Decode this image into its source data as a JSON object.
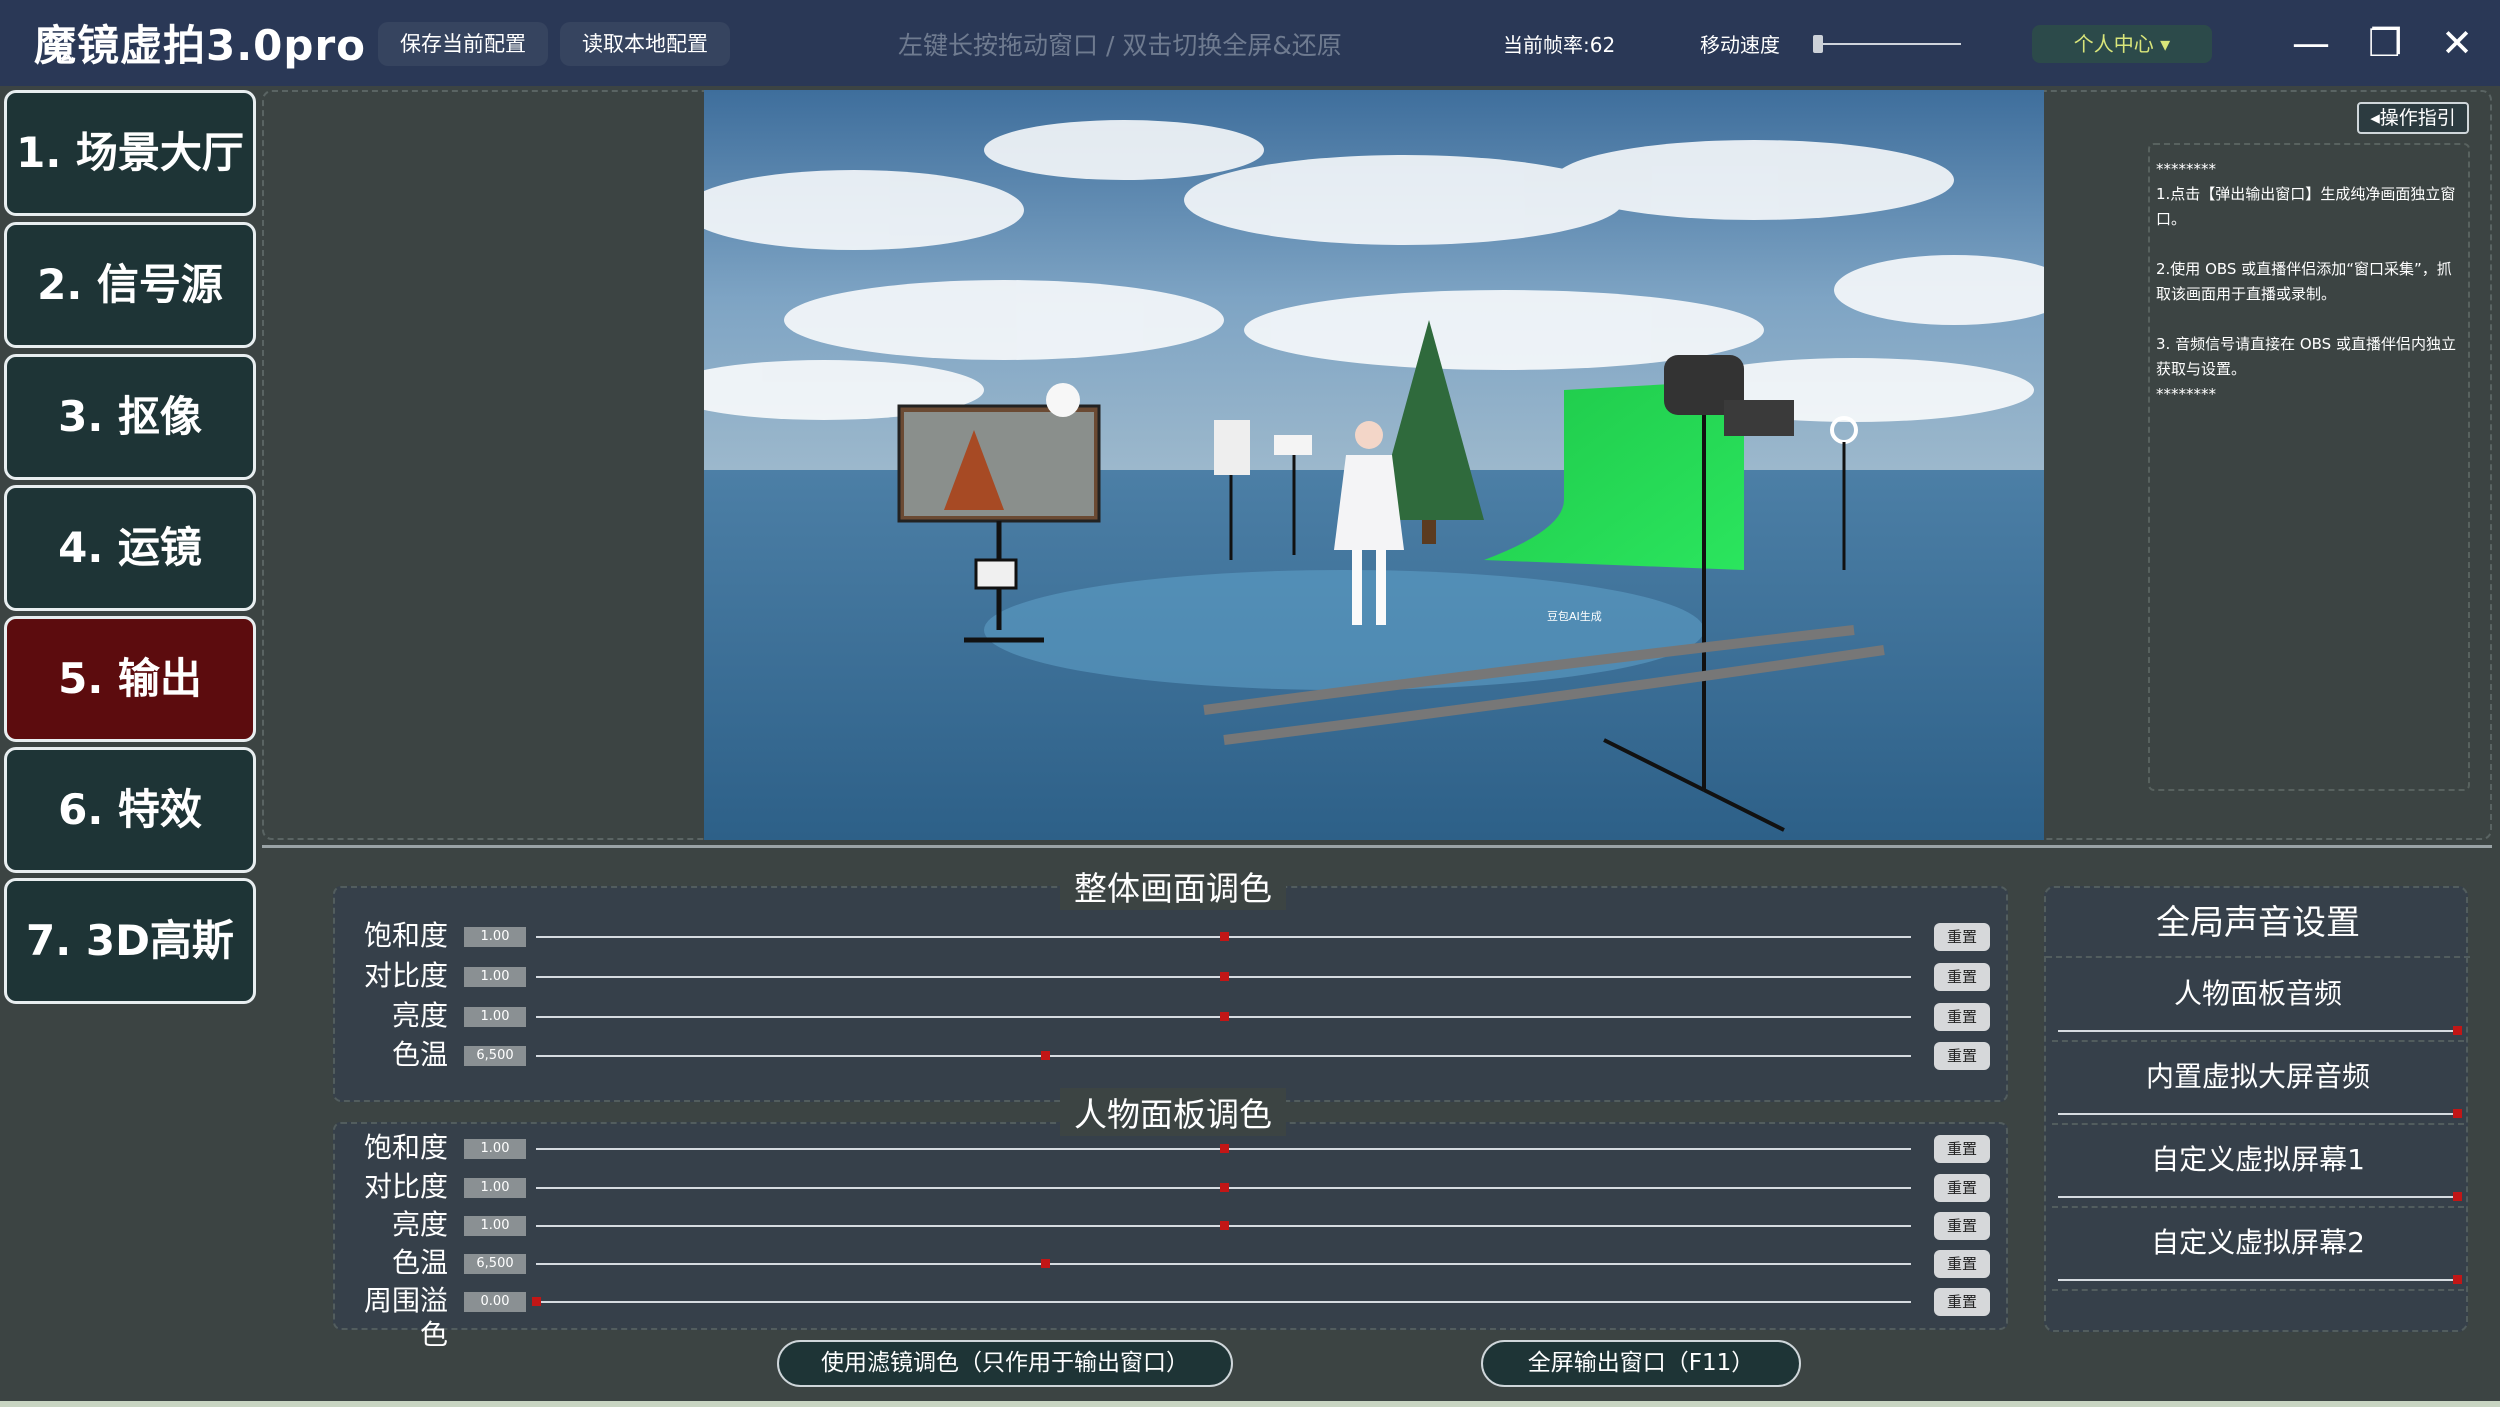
{
  "app": {
    "title": "魔镜虚拍3.0pro",
    "save_config": "保存当前配置",
    "load_config": "读取本地配置",
    "hint": "左键长按拖动窗口 / 双击切换全屏&还原",
    "fps_label": "当前帧率:62",
    "speed_label": "移动速度",
    "user_center": "个人中心 ▾",
    "window_controls": {
      "minimize": "—",
      "maximize": "❐",
      "close": "✕"
    }
  },
  "sidebar": {
    "items": [
      {
        "label": "1. 场景大厅",
        "active": false
      },
      {
        "label": "2. 信号源",
        "active": false
      },
      {
        "label": "3. 抠像",
        "active": false
      },
      {
        "label": "4. 运镜",
        "active": false
      },
      {
        "label": "5. 输出",
        "active": true
      },
      {
        "label": "6. 特效",
        "active": false
      },
      {
        "label": "7. 3D高斯",
        "active": false
      }
    ]
  },
  "viewport": {
    "watermark": "豆包AI生成"
  },
  "guide": {
    "button": "◂操作指引",
    "lines": [
      "********",
      "1.点击【弹出输出窗口】生成纯净画面独立窗口。",
      "",
      "2.使用 OBS 或直播伴侣添加“窗口采集”，抓取该画面用于直播或录制。",
      "",
      "3. 音频信号请直接在 OBS 或直播伴侣内独立获取与设置。",
      "********"
    ]
  },
  "overall_color": {
    "title": "整体画面调色",
    "rows": [
      {
        "label": "饱和度",
        "value": "1.00",
        "level": 0.5,
        "reset": "重置"
      },
      {
        "label": "对比度",
        "value": "1.00",
        "level": 0.5,
        "reset": "重置"
      },
      {
        "label": "亮度",
        "value": "1.00",
        "level": 0.5,
        "reset": "重置"
      },
      {
        "label": "色温",
        "value": "6,500",
        "level": 0.37,
        "reset": "重置"
      }
    ]
  },
  "person_color": {
    "title": "人物面板调色",
    "rows": [
      {
        "label": "饱和度",
        "value": "1.00",
        "level": 0.5,
        "reset": "重置"
      },
      {
        "label": "对比度",
        "value": "1.00",
        "level": 0.5,
        "reset": "重置"
      },
      {
        "label": "亮度",
        "value": "1.00",
        "level": 0.5,
        "reset": "重置"
      },
      {
        "label": "色温",
        "value": "6,500",
        "level": 0.37,
        "reset": "重置"
      },
      {
        "label": "周围溢色",
        "value": "0.00",
        "level": 0.0,
        "reset": "重置"
      }
    ]
  },
  "audio": {
    "title": "全局声音设置",
    "items": [
      {
        "label": "人物面板音频",
        "level": 1.0
      },
      {
        "label": "内置虚拟大屏音频",
        "level": 1.0
      },
      {
        "label": "自定义虚拟屏幕1",
        "level": 1.0
      },
      {
        "label": "自定义虚拟屏幕2",
        "level": 1.0
      }
    ]
  },
  "actions": {
    "filter_button": "使用滤镜调色（只作用于输出窗口）",
    "fullscreen_button": "全屏输出窗口（F11）"
  }
}
